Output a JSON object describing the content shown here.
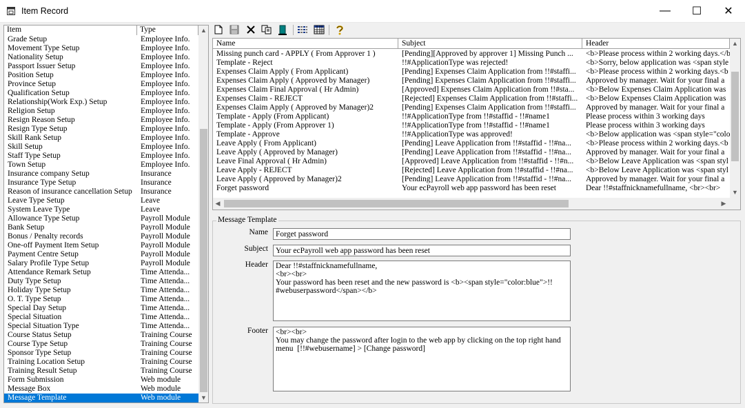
{
  "window": {
    "title": "Item Record",
    "icon": "window-icon",
    "controls": {
      "minimize": "—",
      "maximize": "☐",
      "close": "✕"
    }
  },
  "left_list": {
    "columns": [
      "Item",
      "Type"
    ],
    "selected_index": 41,
    "rows": [
      [
        "Grade Setup",
        "Employee Info."
      ],
      [
        "Movement Type Setup",
        "Employee Info."
      ],
      [
        "Nationality Setup",
        "Employee Info."
      ],
      [
        "Passport Issuer Setup",
        "Employee Info."
      ],
      [
        "Position Setup",
        "Employee Info."
      ],
      [
        "Province Setup",
        "Employee Info."
      ],
      [
        "Qualification Setup",
        "Employee Info."
      ],
      [
        "Relationship(Work Exp.) Setup",
        "Employee Info."
      ],
      [
        "Religion Setup",
        "Employee Info."
      ],
      [
        "Resign Reason Setup",
        "Employee Info."
      ],
      [
        "Resign Type Setup",
        "Employee Info."
      ],
      [
        "Skill Rank Setup",
        "Employee Info."
      ],
      [
        "Skill Setup",
        "Employee Info."
      ],
      [
        "Staff Type Setup",
        "Employee Info."
      ],
      [
        "Town Setup",
        "Employee Info."
      ],
      [
        "Insurance company Setup",
        "Insurance"
      ],
      [
        "Insurance Type Setup",
        "Insurance"
      ],
      [
        "Reason of insurance cancellation Setup",
        "Insurance"
      ],
      [
        "Leave Type Setup",
        "Leave"
      ],
      [
        "System Leave Type",
        "Leave"
      ],
      [
        "Allowance Type Setup",
        "Payroll Module"
      ],
      [
        "Bank Setup",
        "Payroll Module"
      ],
      [
        "Bonus / Penalty records",
        "Payroll Module"
      ],
      [
        "One-off Payment Item Setup",
        "Payroll Module"
      ],
      [
        "Payment Centre Setup",
        "Payroll Module"
      ],
      [
        "Salary Profile Type Setup",
        "Payroll Module"
      ],
      [
        "Attendance Remark Setup",
        "Time Attenda..."
      ],
      [
        "Duty Type Setup",
        "Time Attenda..."
      ],
      [
        "Holiday Type Setup",
        "Time Attenda..."
      ],
      [
        "O. T. Type Setup",
        "Time Attenda..."
      ],
      [
        "Special Day Setup",
        "Time Attenda..."
      ],
      [
        "Special Situation",
        "Time Attenda..."
      ],
      [
        "Special Situation Type",
        "Time Attenda..."
      ],
      [
        "Course Status Setup",
        "Training Course"
      ],
      [
        "Course Type Setup",
        "Training Course"
      ],
      [
        "Sponsor Type Setup",
        "Training Course"
      ],
      [
        "Training Location Setup",
        "Training Course"
      ],
      [
        "Training Result Setup",
        "Training Course"
      ],
      [
        "Form Submission",
        "Web module"
      ],
      [
        "Message Box",
        "Web module"
      ],
      [
        "Message Template",
        "Web module"
      ]
    ]
  },
  "toolbar": {
    "buttons": [
      {
        "name": "new-icon",
        "glyph": "🗋"
      },
      {
        "name": "save-icon",
        "glyph": "💾"
      },
      {
        "name": "delete-icon",
        "glyph": "✕"
      },
      {
        "name": "copy-icon",
        "glyph": "⧉"
      },
      {
        "name": "exit-icon",
        "glyph": "▮"
      },
      {
        "name": "list-view-icon",
        "glyph": "☷"
      },
      {
        "name": "grid-view-icon",
        "glyph": "▦"
      },
      {
        "name": "help-icon",
        "glyph": "?"
      }
    ]
  },
  "grid": {
    "columns": [
      "Name",
      "Subject",
      "Header"
    ],
    "rows": [
      [
        "Missing punch card - APPLY ( From Approver 1 )",
        "[Pending][Approved by approver 1] Missing Punch ...",
        "<b>Please process within 2 working days.</b"
      ],
      [
        "Template - Reject",
        "!!#ApplicationType was rejected!",
        "<b>Sorry, below application was <span style"
      ],
      [
        "Expenses Claim Apply ( From Applicant)",
        "[Pending] Expenses Claim Application from !!#staffi...",
        "<b>Please process within 2 working days.<b"
      ],
      [
        "Expenses Claim Apply ( Approved by Manager)",
        "[Pending] Expenses Claim Application from !!#staffi...",
        "Approved by manager. Wait for your final a"
      ],
      [
        "Expenses Claim Final Approval ( Hr Admin)",
        "[Approved] Expenses Claim Application from !!#sta...",
        "<b>Below Expenses Claim Application was"
      ],
      [
        "Expenses Claim - REJECT",
        "[Rejected] Expenses Claim Application from !!#staffi...",
        "<b>Below Expenses Claim Application was"
      ],
      [
        "Expenses Claim Apply ( Approved by Manager)2",
        "[Pending] Expenses Claim Application from !!#staffi...",
        "Approved by manager. Wait for your final a"
      ],
      [
        "Template - Apply (From Applicant)",
        "!!#ApplicationType from !!#staffid - !!#name1",
        "Please process within 3 working days"
      ],
      [
        "Template - Apply (From Approver 1)",
        "!!#ApplicationType from !!#staffid - !!#name1",
        "Please process within 3 working days"
      ],
      [
        "Template - Approve",
        "!!#ApplicationType was approved!",
        "<b>Below application was <span style=\"colo"
      ],
      [
        "Leave Apply ( From Applicant)",
        "[Pending] Leave Application from !!#staffid - !!#na...",
        "<b>Please process within 2 working days.<b"
      ],
      [
        "Leave Apply ( Approved by Manager)",
        "[Pending] Leave Application from !!#staffid - !!#na...",
        "Approved by manager. Wait for your final a"
      ],
      [
        "Leave Final Approval ( Hr Admin)",
        "[Approved] Leave Application from !!#staffid - !!#n...",
        "<b>Below Leave Application was <span styl"
      ],
      [
        "Leave Apply - REJECT",
        "[Rejected] Leave Application from !!#staffid - !!#na...",
        "<b>Below Leave Application was <span styl"
      ],
      [
        "Leave Apply ( Approved by Manager)2",
        "[Pending] Leave Application from !!#staffid - !!#na...",
        "Approved by manager. Wait for your final a"
      ],
      [
        "Forget password",
        "Your ecPayroll web app password has been reset",
        "Dear !!#staffnicknamefullname,    <br><br>"
      ]
    ]
  },
  "message_template": {
    "legend": "Message Template",
    "name_label": "Name",
    "name_value": "Forget password",
    "subject_label": "Subject",
    "subject_value": "Your ecPayroll web app password has been reset",
    "header_label": "Header",
    "header_value": "Dear !!#staffnicknamefullname,\n<br><br>\nYour password has been reset and the new password is <b><span style=\"color:blue\">!!\n#webuserpassword</span></b>",
    "footer_label": "Footer",
    "footer_value": "<br><br>\nYou may change the password after login to the web app by clicking on the top right hand\nmenu  [!!#webusername] > [Change password]"
  }
}
